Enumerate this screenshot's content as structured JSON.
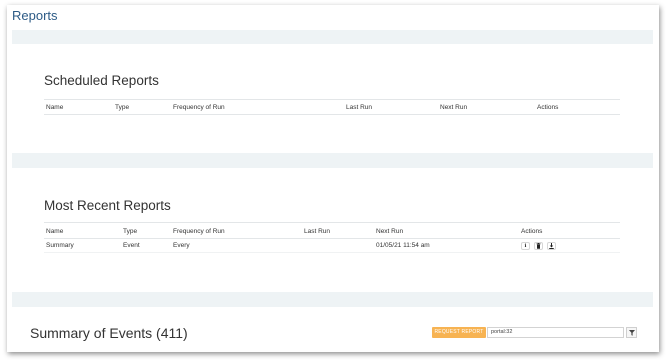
{
  "page": {
    "title": "Reports"
  },
  "scheduled": {
    "title": "Scheduled Reports",
    "columns": [
      "Name",
      "Type",
      "Frequency of Run",
      "Last Run",
      "Next Run",
      "Actions"
    ]
  },
  "recent": {
    "title": "Most Recent Reports",
    "columns": [
      "Name",
      "Type",
      "Frequency of Run",
      "Last Run",
      "Next Run",
      "Actions"
    ],
    "rows": [
      {
        "name": "Summary",
        "type": "Event",
        "frequency": "Every",
        "last_run": "",
        "next_run": "01/05/21 11:54 am",
        "actions": [
          "info-icon",
          "trash-icon",
          "download-icon"
        ]
      }
    ]
  },
  "summary": {
    "title": "Summary of Events (411)",
    "request_button": "REQUEST REPORT",
    "filter_value": "portal:32"
  },
  "colors": {
    "title": "#2d5b86",
    "background": "#eef3f5",
    "accent": "#f7b352"
  }
}
